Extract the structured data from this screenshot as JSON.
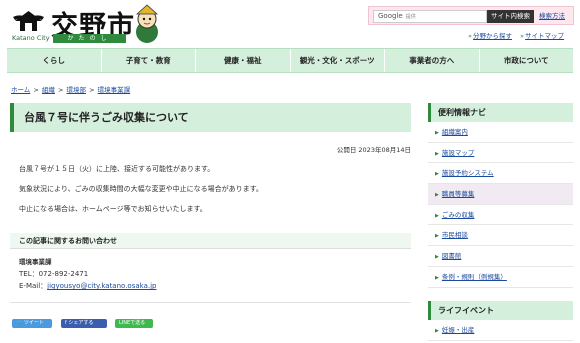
{
  "header": {
    "logo_text": "交野市",
    "logo_en": "Katano City",
    "logo_kana": "かたのし",
    "search": {
      "provider": "Google",
      "placeholder": "提供",
      "button": "サイト内検索",
      "help": "検索方法"
    },
    "sub_links": [
      "分野から探す",
      "サイトマップ"
    ]
  },
  "nav": [
    "くらし",
    "子育て・教育",
    "健康・福祉",
    "観光・文化・スポーツ",
    "事業者の方へ",
    "市政について"
  ],
  "breadcrumb": {
    "items": [
      "ホーム",
      "組織",
      "環境部",
      "環境事業課"
    ],
    "sep": ">"
  },
  "article": {
    "title": "台風７号に伴うごみ収集について",
    "published": "公開日 2023年08月14日",
    "paragraphs": [
      "台風７号が１５日（火）に上陸、接近する可能性があります。",
      "気象状況により、ごみの収集時間の大幅な変更や中止になる場合があります。",
      "中止になる場合は、ホームページ等でお知らせいたします。"
    ],
    "contact": {
      "heading": "この記事に関するお問い合わせ",
      "dept": "環境事業課",
      "tel": "TEL：072-892-2471",
      "email_label": "E-Mail：",
      "email": "jigyousyo@city.katano.osaka.jp"
    }
  },
  "sns": {
    "tweet": "ツイート",
    "facebook": "シェアする",
    "line": "LINEで送る"
  },
  "sidebar": {
    "nav_title": "便利情報ナビ",
    "nav_items": [
      "組織案内",
      "施設マップ",
      "施設予約システム",
      "職員等募集",
      "ごみの収集",
      "市民相談",
      "図書館",
      "条例・規則（例規集）"
    ],
    "life_title": "ライフイベント",
    "life_items": [
      "妊娠・出産"
    ]
  },
  "colors": {
    "accent": "#2f8a3e",
    "nav_bg": "#d5efdd",
    "link": "#1a4a9c"
  }
}
